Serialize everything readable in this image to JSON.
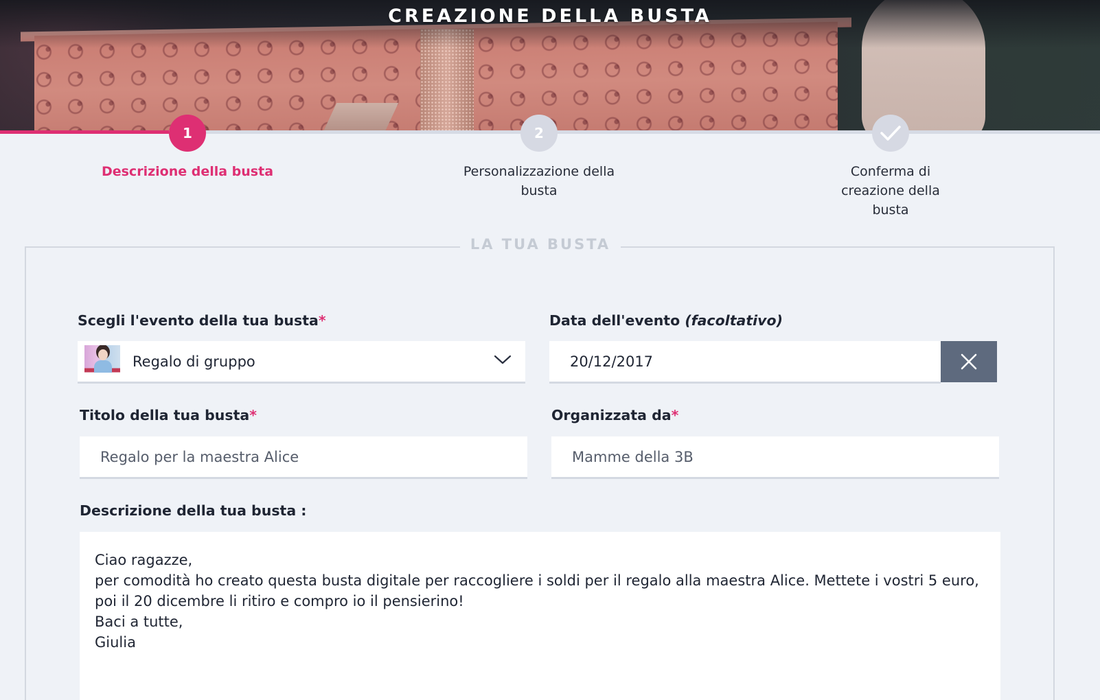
{
  "hero": {
    "title": "CREAZIONE DELLA BUSTA"
  },
  "stepper": {
    "progress": 0.154,
    "steps": [
      {
        "number": "1",
        "label": "Descrizione della busta",
        "state": "active"
      },
      {
        "number": "2",
        "label": "Personalizzazione della busta",
        "state": "inactive"
      },
      {
        "number": "",
        "icon": "check-icon",
        "label": "Conferma di creazione della busta",
        "state": "inactive"
      }
    ]
  },
  "form": {
    "legend": "LA TUA BUSTA",
    "event": {
      "label": "Scegli l'evento della tua busta",
      "required_mark": "*",
      "value": "Regalo di gruppo",
      "icon": "chevron-down-icon"
    },
    "date": {
      "label": "Data dell'evento ",
      "optional_label": "(facoltativo)",
      "value": "20/12/2017",
      "clear_icon": "close-icon"
    },
    "title": {
      "label": "Titolo della tua busta",
      "required_mark": "*",
      "value": "Regalo per la maestra Alice"
    },
    "organizer": {
      "label": "Organizzata da",
      "required_mark": "*",
      "value": "Mamme della 3B"
    },
    "description": {
      "label": "Descrizione della tua busta :",
      "lines": [
        "Ciao ragazze,",
        "per comodità ho creato questa busta digitale per raccogliere i soldi per il regalo alla maestra Alice. Mettete i vostri 5 euro, poi il 20 dicembre li ritiro e compro io il pensierino!",
        "Baci a tutte,",
        "Giulia"
      ]
    }
  },
  "colors": {
    "accent": "#de2f73",
    "background": "#eff2f7",
    "inactive_step": "#d6d9e3",
    "clear_button": "#5e6a7e"
  }
}
